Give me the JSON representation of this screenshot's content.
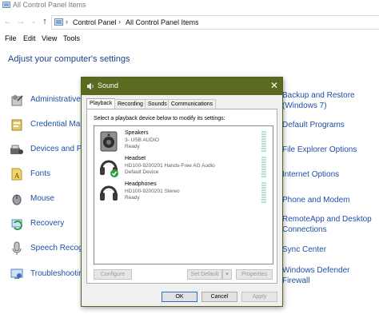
{
  "window": {
    "title": "All Control Panel Items"
  },
  "address": {
    "crumbs": [
      "Control Panel",
      "All Control Panel Items"
    ]
  },
  "menu": [
    "File",
    "Edit",
    "View",
    "Tools"
  ],
  "heading": "Adjust your computer's settings",
  "left_items": [
    {
      "label": "Administrative",
      "icon": "admin-tools-icon"
    },
    {
      "label": "Credential Mar",
      "icon": "credential-icon"
    },
    {
      "label": "Devices and Pr",
      "icon": "devices-icon"
    },
    {
      "label": "Fonts",
      "icon": "fonts-icon"
    },
    {
      "label": "Mouse",
      "icon": "mouse-icon"
    },
    {
      "label": "Recovery",
      "icon": "recovery-icon"
    },
    {
      "label": "Speech Recogr",
      "icon": "microphone-icon"
    },
    {
      "label": "Troubleshootin",
      "icon": "troubleshoot-icon"
    }
  ],
  "right_items": [
    {
      "line1": "Backup and Restore",
      "line2": "(Windows 7)"
    },
    {
      "line1": "Default Programs",
      "line2": ""
    },
    {
      "line1": "File Explorer Options",
      "line2": ""
    },
    {
      "line1": "Internet Options",
      "line2": ""
    },
    {
      "line1": "Phone and Modem",
      "line2": ""
    },
    {
      "line1": "RemoteApp and Desktop",
      "line2": "Connections"
    },
    {
      "line1": "Sync Center",
      "line2": ""
    },
    {
      "line1": "Windows Defender",
      "line2": "Firewall"
    }
  ],
  "dialog": {
    "title": "Sound",
    "close_glyph": "✕",
    "tabs": [
      "Playback",
      "Recording",
      "Sounds",
      "Communications"
    ],
    "instruction": "Select a playback device below to modify its settings:",
    "devices": [
      {
        "name": "Speakers",
        "sub": "3- USB AUDIO",
        "state": "Ready",
        "icon": "speaker-icon"
      },
      {
        "name": "Headset",
        "sub": "HD100-9200201 Hands-Free AG Audio",
        "state": "Default Device",
        "icon": "headset-icon"
      },
      {
        "name": "Headphones",
        "sub": "HD100-9200201 Stereo",
        "state": "Ready",
        "icon": "headphones-icon"
      }
    ],
    "buttons": {
      "configure": "Configure",
      "set_default": "Set Default",
      "properties": "Properties",
      "ok": "OK",
      "cancel": "Cancel",
      "apply": "Apply"
    }
  },
  "colors": {
    "dialog_title": "#5a6a1f",
    "link": "#1f4fa6",
    "heading": "#1e3f8f",
    "default_check": "#2e9e3e"
  }
}
